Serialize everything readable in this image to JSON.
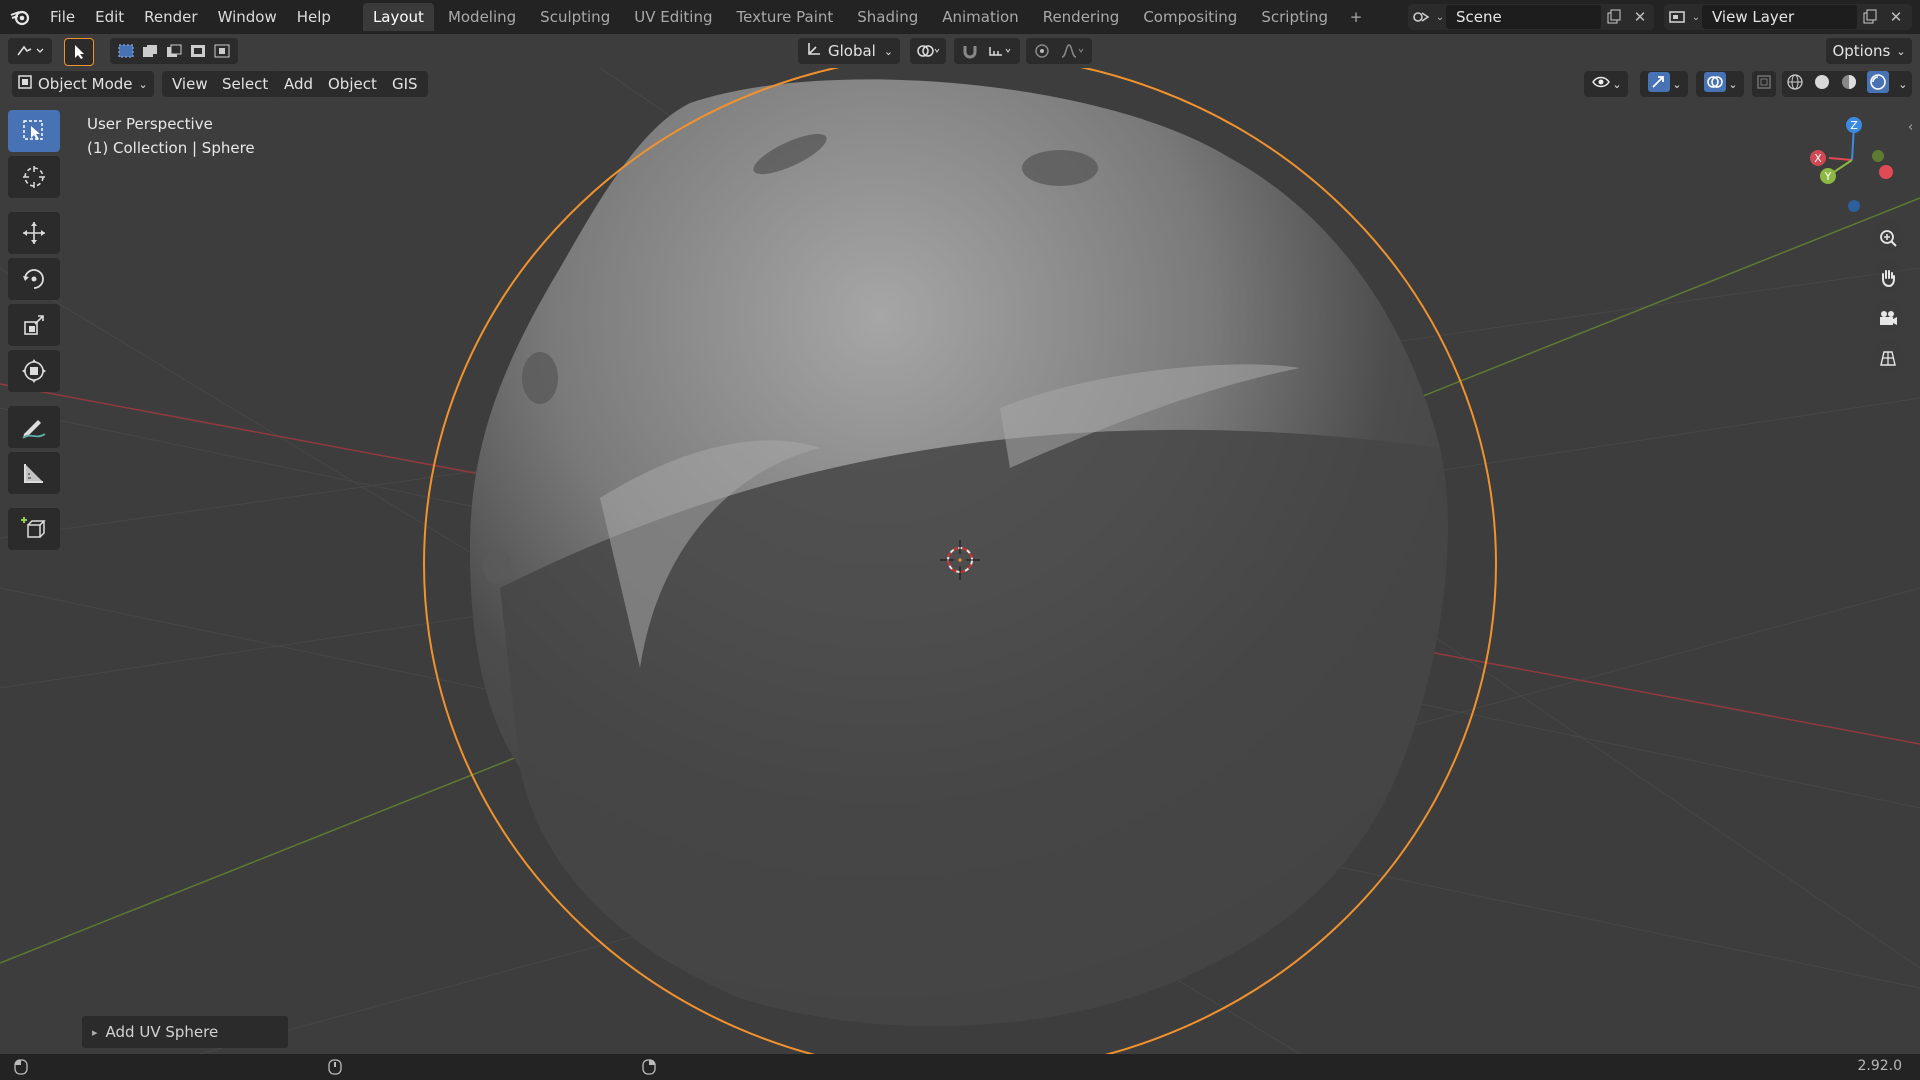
{
  "menu": [
    "File",
    "Edit",
    "Render",
    "Window",
    "Help"
  ],
  "workspace_tabs": [
    {
      "label": "Layout",
      "active": true
    },
    {
      "label": "Modeling",
      "active": false
    },
    {
      "label": "Sculpting",
      "active": false
    },
    {
      "label": "UV Editing",
      "active": false
    },
    {
      "label": "Texture Paint",
      "active": false
    },
    {
      "label": "Shading",
      "active": false
    },
    {
      "label": "Animation",
      "active": false
    },
    {
      "label": "Rendering",
      "active": false
    },
    {
      "label": "Compositing",
      "active": false
    },
    {
      "label": "Scripting",
      "active": false
    }
  ],
  "add_tab_icon": "plus-icon",
  "scene": {
    "value": "Scene"
  },
  "view_layer": {
    "value": "View Layer"
  },
  "header": {
    "transform_orientation": "Global",
    "options_label": "Options"
  },
  "viewport_header": {
    "mode": "Object Mode",
    "menus": [
      "View",
      "Select",
      "Add",
      "Object",
      "GIS"
    ]
  },
  "overlay": {
    "perspective": "User Perspective",
    "collection": "(1) Collection | Sphere"
  },
  "gizmo_axes": {
    "x": "X",
    "y": "Y",
    "z": "Z"
  },
  "last_operator": {
    "label": "Add UV Sphere"
  },
  "status": {
    "version": "2.92.0"
  },
  "colors": {
    "accent": "#4772b3",
    "selection_outline": "#f0922d",
    "x_axis": "#e04a55",
    "y_axis": "#8cb843",
    "z_axis": "#3b8ae0"
  }
}
